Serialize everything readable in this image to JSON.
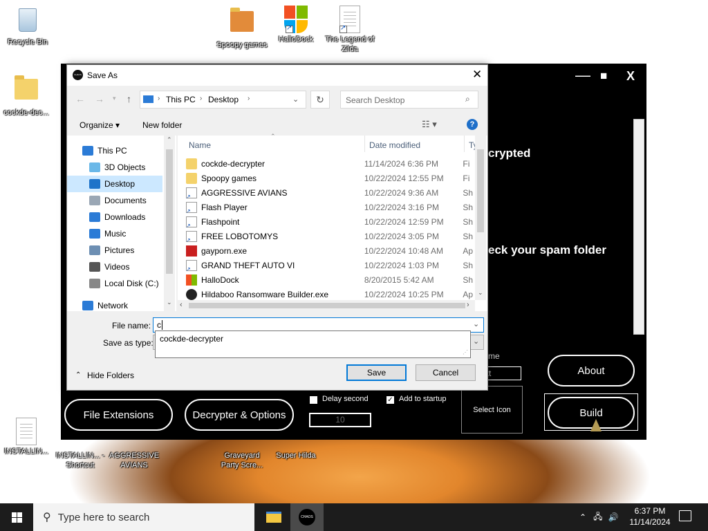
{
  "desktop": {
    "icons": [
      {
        "label": "Recycle Bin"
      },
      {
        "label": "cockde-dec..."
      },
      {
        "label": "Spoopy games"
      },
      {
        "label": "HalloDock"
      },
      {
        "label": "The Legend of Zilda"
      },
      {
        "label": "INSTALLIN..."
      },
      {
        "label": "INSTALLIN... - Shortcut"
      },
      {
        "label": "AGGRESSIVE AVIANS"
      },
      {
        "label": "Graveyard Party Scre..."
      },
      {
        "label": "Super Hilda"
      }
    ]
  },
  "app": {
    "window_controls": {
      "minimize": "—",
      "maximize": "■",
      "close": "X"
    },
    "text_fragment_1": "crypted",
    "text_fragment_2": "eck your spam folder",
    "partial_label": "me",
    "partial_input": "xt",
    "buttons": {
      "about": "About",
      "build": "Build",
      "file_extensions": "File Extensions",
      "decrypter_options": "Decrypter & Options",
      "select_icon": "Select Icon"
    },
    "delay_second": {
      "label": "Delay second",
      "checked": false,
      "value": "10"
    },
    "add_to_startup": {
      "label": "Add to startup",
      "checked": true
    }
  },
  "dialog": {
    "title": "Save As",
    "app_icon_text": "CHAOS",
    "breadcrumb": [
      "This PC",
      "Desktop"
    ],
    "search_placeholder": "Search Desktop",
    "toolbar": {
      "organize": "Organize ▾",
      "new_folder": "New folder"
    },
    "nav_items": [
      {
        "label": "This PC",
        "color": "#2b7bd6"
      },
      {
        "label": "3D Objects",
        "color": "#6bb8e8"
      },
      {
        "label": "Desktop",
        "color": "#1e73c9",
        "selected": true
      },
      {
        "label": "Documents",
        "color": "#9aa7b5"
      },
      {
        "label": "Downloads",
        "color": "#2b7bd6"
      },
      {
        "label": "Music",
        "color": "#2b7bd6"
      },
      {
        "label": "Pictures",
        "color": "#6d8fb3"
      },
      {
        "label": "Videos",
        "color": "#555"
      },
      {
        "label": "Local Disk (C:)",
        "color": "#888"
      },
      {
        "label": "Network",
        "color": "#2b7bd6"
      }
    ],
    "columns": {
      "name": "Name",
      "date": "Date modified",
      "type": "Ty"
    },
    "files": [
      {
        "name": "cockde-decrypter",
        "date": "11/14/2024 6:36 PM",
        "type": "Fi",
        "icon": "folder"
      },
      {
        "name": "Spoopy games",
        "date": "10/22/2024 12:55 PM",
        "type": "Fi",
        "icon": "folder"
      },
      {
        "name": "AGGRESSIVE AVIANS",
        "date": "10/22/2024 9:36 AM",
        "type": "Sh",
        "icon": "doc"
      },
      {
        "name": "Flash Player",
        "date": "10/22/2024 3:16 PM",
        "type": "Sh",
        "icon": "doc"
      },
      {
        "name": "Flashpoint",
        "date": "10/22/2024 12:59 PM",
        "type": "Sh",
        "icon": "doc"
      },
      {
        "name": "FREE LOBOTOMYS",
        "date": "10/22/2024 3:05 PM",
        "type": "Sh",
        "icon": "doc"
      },
      {
        "name": "gayporn.exe",
        "date": "10/22/2024 10:48 AM",
        "type": "Ap",
        "icon": "exe"
      },
      {
        "name": "GRAND THEFT AUTO VI",
        "date": "10/22/2024 1:03 PM",
        "type": "Sh",
        "icon": "doc"
      },
      {
        "name": "HalloDock",
        "date": "8/20/2015 5:42 AM",
        "type": "Sh",
        "icon": "shield"
      },
      {
        "name": "Hildaboo Ransomware Builder.exe",
        "date": "10/22/2024 10:25 PM",
        "type": "Ap",
        "icon": "blk"
      }
    ],
    "file_name_label": "File name:",
    "file_name_value": "c",
    "save_as_type_label": "Save as type:",
    "autocomplete": [
      "cockde-decrypter"
    ],
    "hide_folders": "Hide Folders",
    "save": "Save",
    "cancel": "Cancel"
  },
  "taskbar": {
    "search_placeholder": "Type here to search",
    "time": "6:37 PM",
    "date": "11/14/2024",
    "pinned_app": "CHAOS"
  }
}
